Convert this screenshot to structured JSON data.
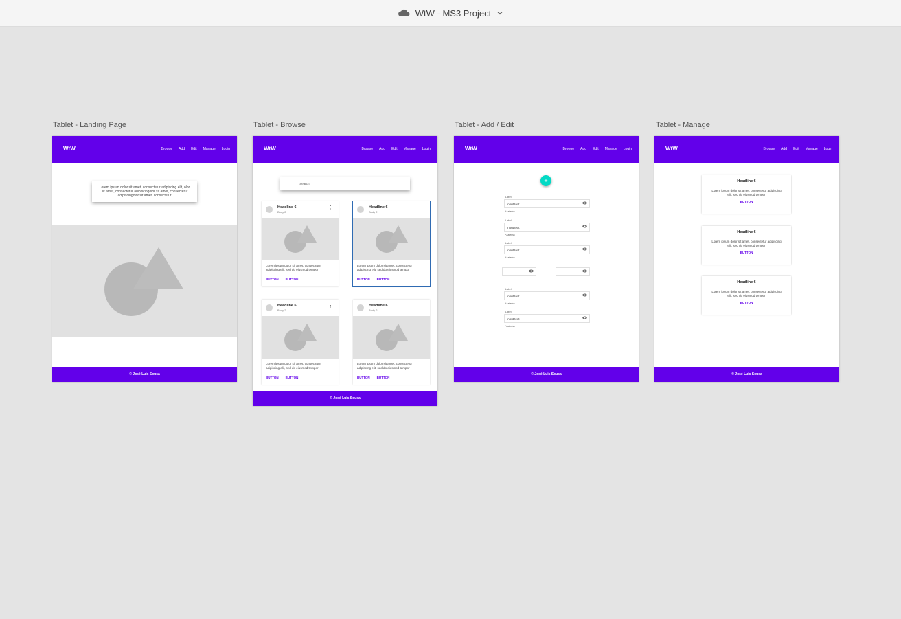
{
  "app": {
    "title": "WtW - MS3 Project",
    "cloud_icon": "cloud-icon",
    "chevron_icon": "chevron-down-icon"
  },
  "colors": {
    "primary": "#6200ea",
    "accent": "#03dac5",
    "canvas": "#e4e4e4",
    "placeholder": "#e1e1e1",
    "shape": "#b8b8b8"
  },
  "nav": {
    "logo": "WtW",
    "links": [
      "Browse",
      "Add",
      "Edit",
      "Manage",
      "Login"
    ]
  },
  "footer": {
    "text": "© José Luis Sousa"
  },
  "artboards": [
    {
      "label": "Tablet - Landing Page",
      "hero_text": "Lorem ipsum dolor sit amet, consectetur adipiscing elit, olor sit amet, consectetur adipiscingolor sit amet, consectetur adipiscingolor sit amet, consectetur"
    },
    {
      "label": "Tablet - Browse",
      "search_label": "Search:",
      "cards": [
        {
          "headline": "Headline 6",
          "body": "Body 2",
          "text": "Lorem ipsum dolor sit amet, consectetur adipiscing elit, sed do eiusmod tempor",
          "buttons": [
            "BUTTON",
            "BUTTON"
          ],
          "selected": false
        },
        {
          "headline": "Headline 6",
          "body": "Body 2",
          "text": "Lorem ipsum dolor sit amet, consectetur adipiscing elit, sed do eiusmod tempor",
          "buttons": [
            "BUTTON",
            "BUTTON"
          ],
          "selected": true
        },
        {
          "headline": "Headline 6",
          "body": "Body 2",
          "text": "Lorem ipsum dolor sit amet, consectetur adipiscing elit, sed do eiusmod tempor",
          "buttons": [
            "BUTTON",
            "BUTTON"
          ],
          "selected": false
        },
        {
          "headline": "Headline 6",
          "body": "Body 2",
          "text": "Lorem ipsum dolor sit amet, consectetur adipiscing elit, sed do eiusmod tempor",
          "buttons": [
            "BUTTON",
            "BUTTON"
          ],
          "selected": false
        }
      ]
    },
    {
      "label": "Tablet - Add / Edit",
      "fab": "+",
      "fields": [
        {
          "label": "Label",
          "value": "Input text",
          "helper": "*Asterisk"
        },
        {
          "label": "Label",
          "value": "Input text",
          "helper": "*Asterisk"
        },
        {
          "label": "Label",
          "value": "Input text",
          "helper": "*Asterisk"
        },
        {
          "label": "Label",
          "value": "Input text",
          "helper": "*Asterisk"
        },
        {
          "label": "Label",
          "value": "Input text",
          "helper": "*Asterisk"
        }
      ]
    },
    {
      "label": "Tablet - Manage",
      "cards": [
        {
          "headline": "Headline 6",
          "text": "Lorem ipsum dolor sit amet, consectetur adipiscing elit, sed do eiusmod tempor",
          "button": "BUTTON"
        },
        {
          "headline": "Headline 6",
          "text": "Lorem ipsum dolor sit amet, consectetur adipiscing elit, sed do eiusmod tempor",
          "button": "BUTTON"
        },
        {
          "headline": "Headline 6",
          "text": "Lorem ipsum dolor sit amet, consectetur adipiscing elit, sed do eiusmod tempor",
          "button": "BUTTON"
        }
      ]
    }
  ]
}
